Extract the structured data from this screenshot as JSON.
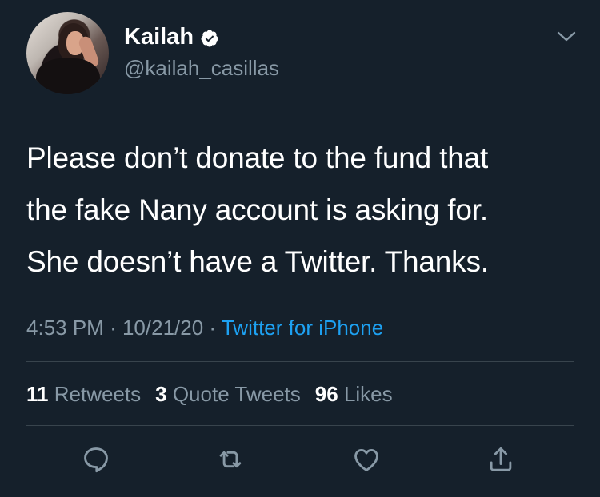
{
  "author": {
    "name": "Kailah",
    "handle": "@kailah_casillas",
    "verified": true,
    "avatar": "profile-photo"
  },
  "tweet": {
    "lines": [
      "Please don’t donate to the fund that",
      "the fake Nany account is asking for.",
      "She doesn’t have a Twitter. Thanks."
    ],
    "time": "4:53 PM",
    "date": "10/21/20",
    "separator": "·",
    "source": "Twitter for iPhone"
  },
  "stats": {
    "retweets_count": "11",
    "retweets_label": "Retweets",
    "quote_count": "3",
    "quote_label": "Quote Tweets",
    "likes_count": "96",
    "likes_label": "Likes"
  },
  "actions": [
    {
      "icon": "reply-icon"
    },
    {
      "icon": "retweet-icon"
    },
    {
      "icon": "like-icon"
    },
    {
      "icon": "share-icon"
    }
  ],
  "colors": {
    "background": "#15202b",
    "text": "#ffffff",
    "secondary": "#8899a6",
    "link": "#1da1f2",
    "divider": "#38444d"
  }
}
